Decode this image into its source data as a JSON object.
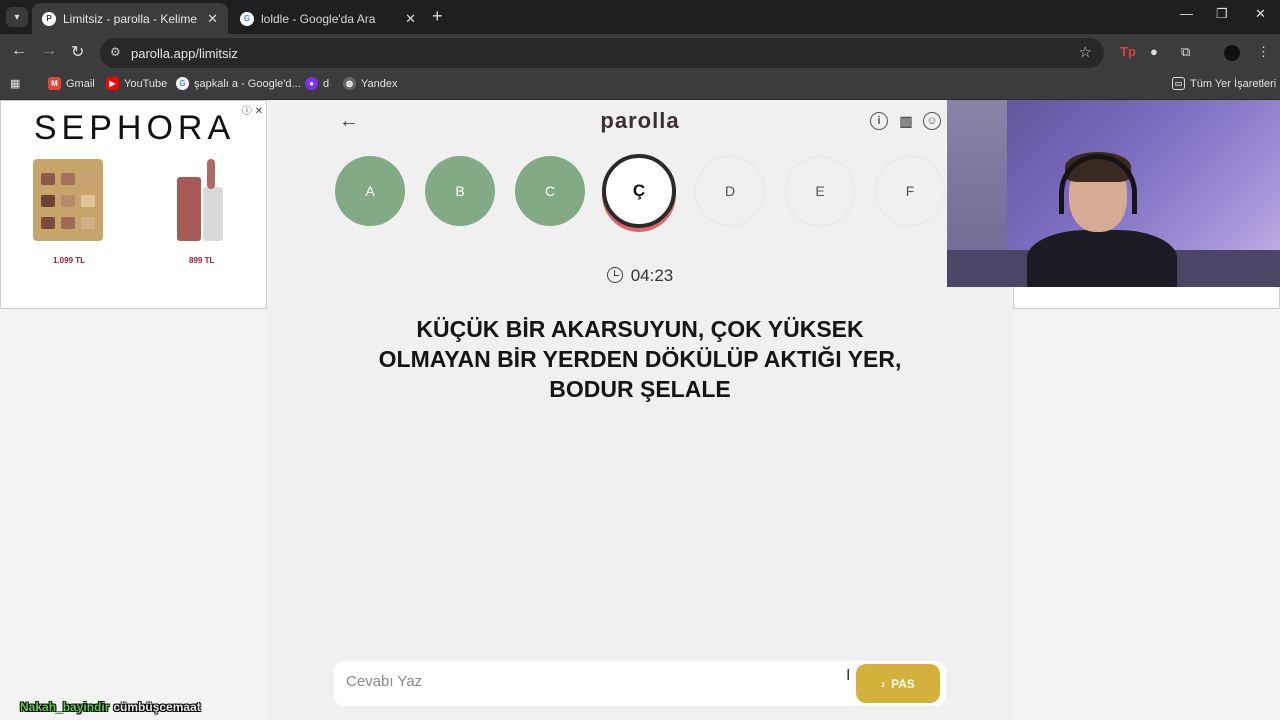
{
  "browser": {
    "tabs": [
      {
        "title": "Limitsiz - parolla - Kelime oyunu",
        "active": true
      },
      {
        "title": "loldle - Google'da Ara",
        "active": false
      }
    ],
    "url": "parolla.app/limitsiz",
    "bookmarks": [
      {
        "label": "Gmail",
        "icon": "gmail-icon",
        "color": "#ea4335"
      },
      {
        "label": "YouTube",
        "icon": "youtube-icon",
        "color": "#ff0000"
      },
      {
        "label": "şapkalı a - Google'd...",
        "icon": "google-icon",
        "color": "#4285f4"
      },
      {
        "label": "d",
        "icon": "bookmark-favicon",
        "color": "#7b2ff7"
      },
      {
        "label": "Yandex",
        "icon": "globe-icon",
        "color": "#888888"
      }
    ],
    "all_bookmarks_label": "Tüm Yer İşaretleri"
  },
  "ad_left": {
    "brand": "SEPHORA",
    "products": [
      {
        "price": "1.099 TL"
      },
      {
        "price": "899 TL"
      }
    ]
  },
  "game": {
    "logo": "parolla",
    "letters": [
      {
        "char": "A",
        "state": "done"
      },
      {
        "char": "B",
        "state": "done"
      },
      {
        "char": "C",
        "state": "done"
      },
      {
        "char": "Ç",
        "state": "current"
      },
      {
        "char": "D",
        "state": "todo"
      },
      {
        "char": "E",
        "state": "todo"
      },
      {
        "char": "F",
        "state": "todo"
      }
    ],
    "timer": "04:23",
    "question": "KÜÇÜK BİR AKARSUYUN, ÇOK YÜKSEK OLMAYAN BİR YERDEN DÖKÜLÜP AKTIĞI YER, BODUR ŞELALE",
    "answer_placeholder": "Cevabı Yaz",
    "pass_label": "PAS",
    "colors": {
      "done": "#82aa85",
      "current_ring": "#2a2a2a",
      "current_accent": "#e0636a",
      "pass_button": "#d4b13a"
    }
  },
  "chat_overlay": {
    "user": "Nakah_bayindir",
    "message": "cümbüşcemaat"
  }
}
